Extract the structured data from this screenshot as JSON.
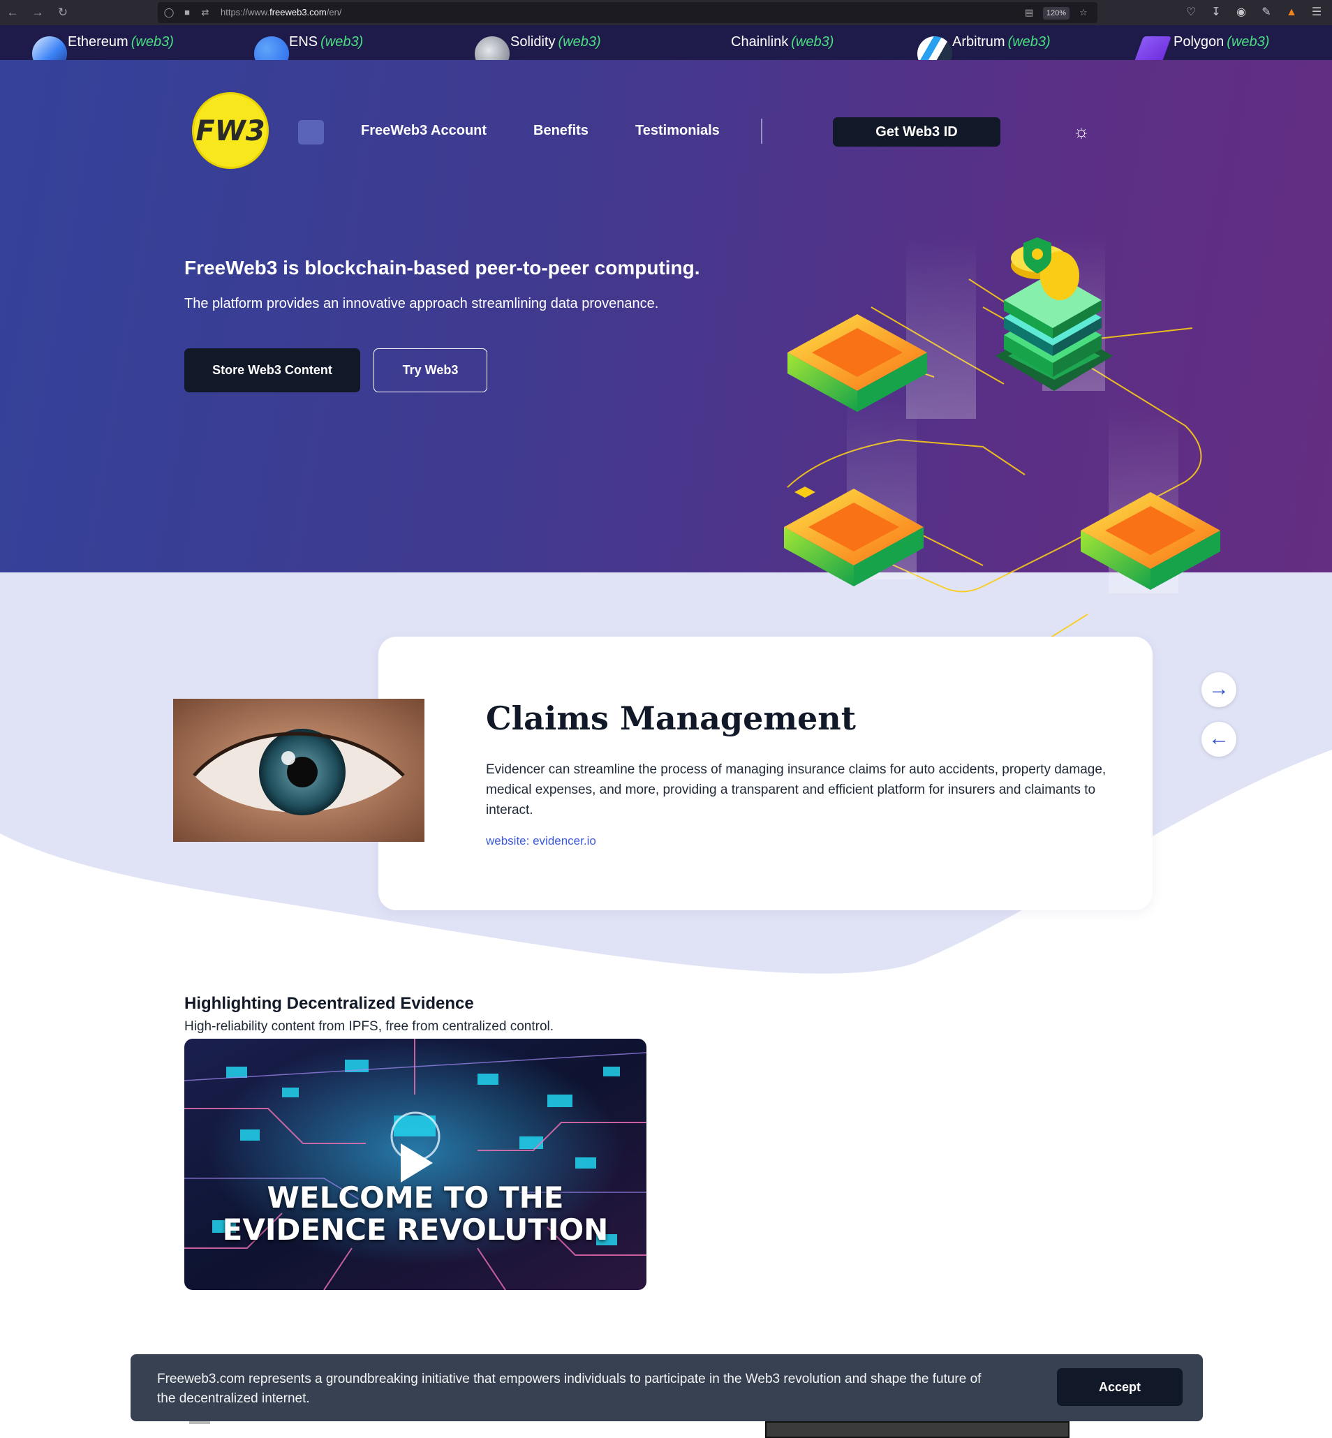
{
  "browser": {
    "url_prefix": "https://www.",
    "url_domain": "freeweb3.com",
    "url_path": "/en/",
    "zoom": "120%"
  },
  "ticker": {
    "items": [
      {
        "name": "Ethereum",
        "suffix": "(web3)"
      },
      {
        "name": "ENS",
        "suffix": "(web3)"
      },
      {
        "name": "Solidity",
        "suffix": "(web3)"
      },
      {
        "name": "Chainlink",
        "suffix": "(web3)"
      },
      {
        "name": "Arbitrum",
        "suffix": "(web3)"
      },
      {
        "name": "Polygon",
        "suffix": "(web3)"
      }
    ]
  },
  "header": {
    "logo_text": "FW3",
    "nav": [
      "FreeWeb3 Account",
      "Benefits",
      "Testimonials"
    ],
    "cta": "Get Web3 ID"
  },
  "hero": {
    "title": "FreeWeb3 is blockchain-based peer-to-peer computing.",
    "subtitle": "The platform provides an innovative approach streamlining data provenance.",
    "primary_button": "Store Web3 Content",
    "secondary_button": "Try Web3"
  },
  "carousel": {
    "title": "Claims Management",
    "body": "Evidencer can streamline the process of managing insurance claims for auto accidents, property damage, medical expenses, and more, providing a transparent and efficient platform for insurers and claimants to interact.",
    "link": "website: evidencer.io"
  },
  "section": {
    "title": "Highlighting Decentralized Evidence",
    "subtitle": "High-reliability content from IPFS, free from centralized control.",
    "video_caption_line1": "WELCOME TO THE",
    "video_caption_line2": "EVIDENCE REVOLUTION"
  },
  "cookie": {
    "text": "Freeweb3.com represents a groundbreaking initiative that empowers individuals to participate in the Web3 revolution and shape the future of the decentralized internet.",
    "accept": "Accept"
  },
  "colors": {
    "ticker_bg": "#1e1b4b",
    "ticker_suffix": "#4ade80",
    "hero_start": "#34429a",
    "hero_end": "#642e82",
    "lavender": "#e0e3f6",
    "dark_button": "#111827",
    "link": "#3b5bdb"
  }
}
